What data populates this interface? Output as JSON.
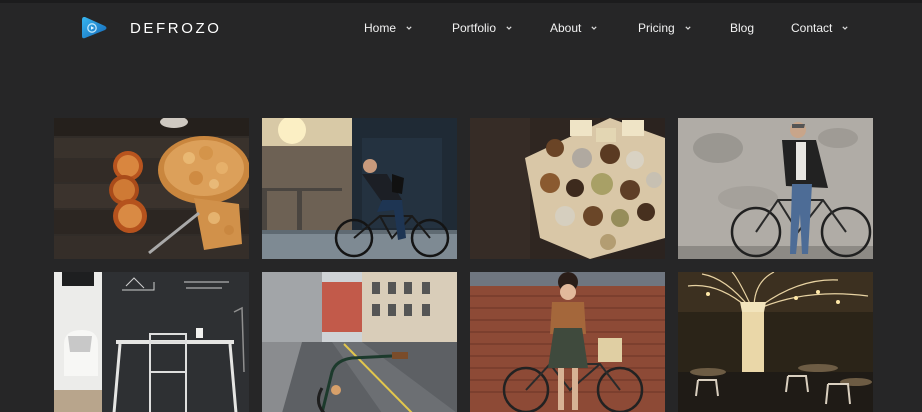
{
  "brand": {
    "name": "DEFROZO",
    "logo_icon": "play-triangle-icon",
    "accent_color": "#1e8fd6"
  },
  "nav": {
    "items": [
      {
        "label": "Home",
        "has_dropdown": true
      },
      {
        "label": "Portfolio",
        "has_dropdown": true
      },
      {
        "label": "About",
        "has_dropdown": true
      },
      {
        "label": "Pricing",
        "has_dropdown": true
      },
      {
        "label": "Blog",
        "has_dropdown": false
      },
      {
        "label": "Contact",
        "has_dropdown": true
      }
    ]
  },
  "gallery": {
    "background_color": "#262627",
    "tiles": [
      {
        "subject": "pie-and-dried-oranges"
      },
      {
        "subject": "cyclist-on-street"
      },
      {
        "subject": "chocolate-truffles"
      },
      {
        "subject": "woman-with-bicycle-by-wall"
      },
      {
        "subject": "chalkboard-workspace"
      },
      {
        "subject": "city-street-bicycle"
      },
      {
        "subject": "woman-with-bicycle-brick-wall"
      },
      {
        "subject": "restaurant-interior"
      }
    ]
  }
}
